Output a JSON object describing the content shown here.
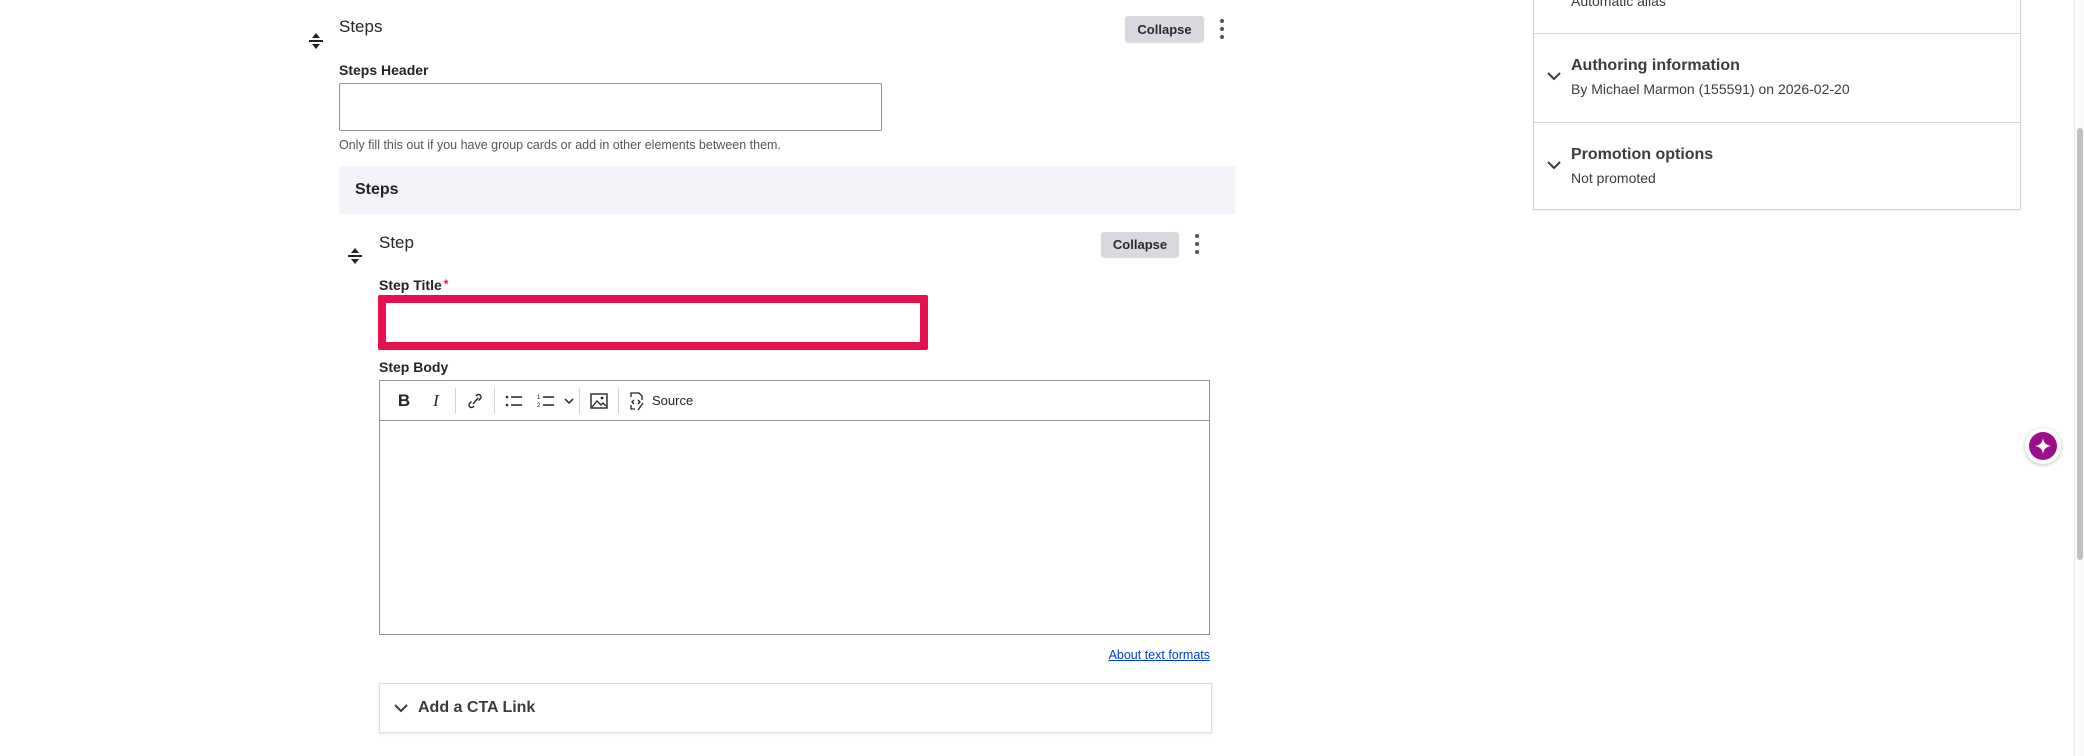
{
  "steps_widget": {
    "title": "Steps",
    "collapse_label": "Collapse",
    "header_label": "Steps Header",
    "header_value": "",
    "header_help": "Only fill this out if you have group cards or add in other elements between them.",
    "band_title": "Steps"
  },
  "step": {
    "title": "Step",
    "collapse_label": "Collapse",
    "title_label": "Step Title",
    "required_mark": "*",
    "title_value": "",
    "body_label": "Step Body",
    "toolbar": {
      "bold": "B",
      "italic": "I",
      "source": "Source"
    },
    "about_formats": "About text formats",
    "cta_label": "Add a CTA Link"
  },
  "sidebar": {
    "partial_text": "Automatic alias",
    "sections": [
      {
        "title": "Authoring information",
        "summary": "By Michael Marmon (155591) on 2026-02-20"
      },
      {
        "title": "Promotion options",
        "summary": "Not promoted"
      }
    ]
  },
  "colors": {
    "error": "#e5114c",
    "link": "#003ecc",
    "assistant": "#9c0f8c"
  }
}
